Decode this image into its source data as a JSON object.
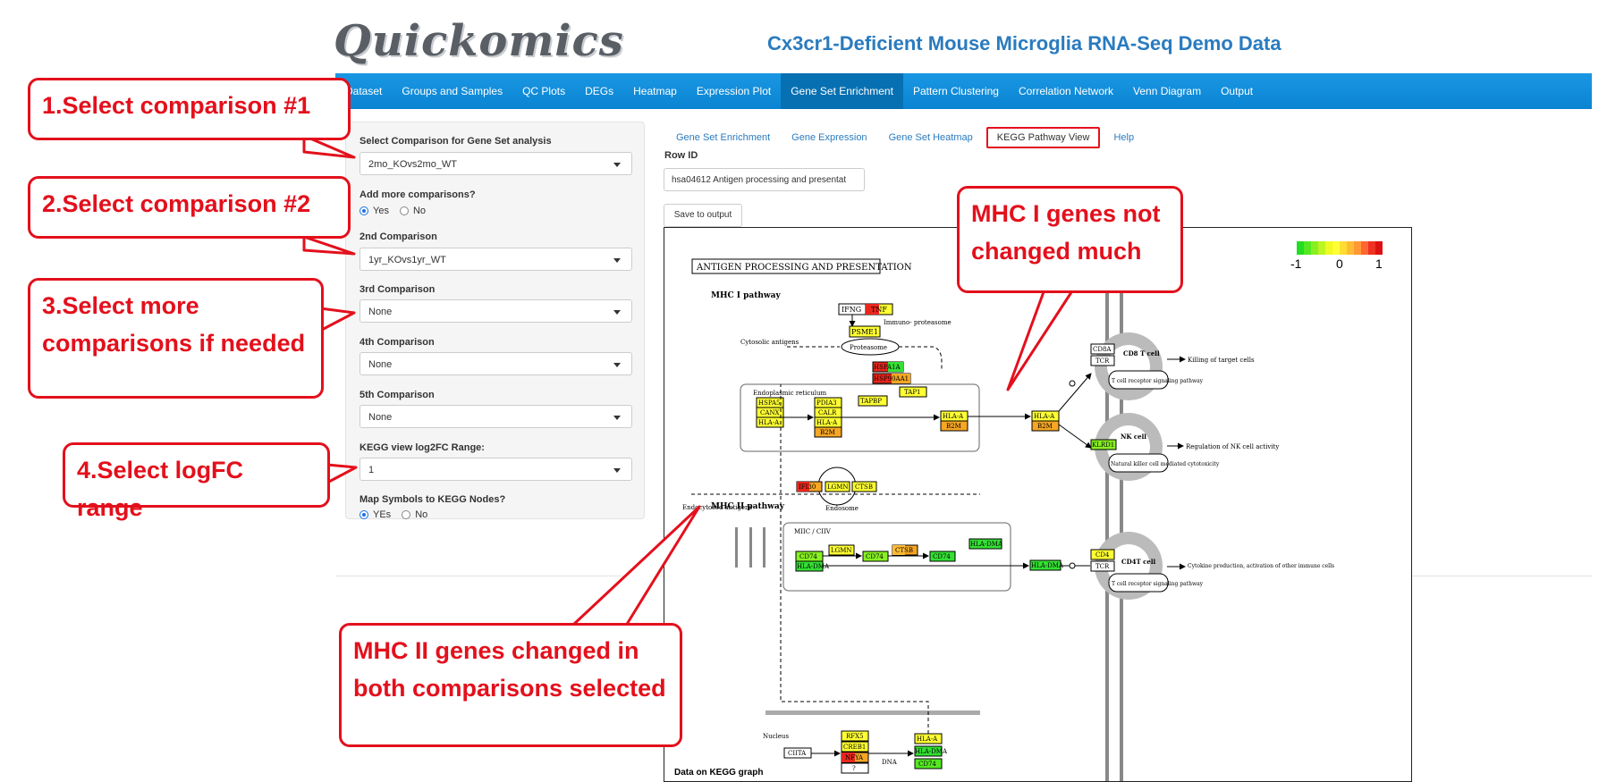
{
  "app": {
    "logo": "Quickomics",
    "title": "Cx3cr1-Deficient Mouse Microglia RNA-Seq Demo Data"
  },
  "nav": [
    "Dataset",
    "Groups and Samples",
    "QC Plots",
    "DEGs",
    "Heatmap",
    "Expression Plot",
    "Gene Set Enrichment",
    "Pattern Clustering",
    "Correlation Network",
    "Venn Diagram",
    "Output"
  ],
  "sidebar": {
    "comp1_label": "Select Comparison for Gene Set analysis",
    "comp1_value": "2mo_KOvs2mo_WT",
    "more_label": "Add more comparisons?",
    "more_yes": "Yes",
    "more_no": "No",
    "comp2_label": "2nd Comparison",
    "comp2_value": "1yr_KOvs1yr_WT",
    "comp3_label": "3rd Comparison",
    "comp3_value": "None",
    "comp4_label": "4th Comparison",
    "comp4_value": "None",
    "comp5_label": "5th Comparison",
    "comp5_value": "None",
    "range_label": "KEGG view log2FC Range:",
    "range_value": "1",
    "map_label": "Map Symbols to KEGG Nodes?",
    "map_yes": "YEs",
    "map_no": "No"
  },
  "subtabs": [
    "Gene Set Enrichment",
    "Gene Expression",
    "Gene Set Heatmap",
    "KEGG Pathway View",
    "Help"
  ],
  "main": {
    "rowid_label": "Row ID",
    "rowid_value": "hsa04612 Antigen processing and presentat",
    "save_label": "Save to output",
    "footer": "Data on KEGG graph"
  },
  "kegg": {
    "title": "ANTIGEN PROCESSING AND PRESENTATION",
    "mhc1": "MHC I pathway",
    "mhc2": "MHC II pathway",
    "scale": [
      "-1",
      "0",
      "1"
    ],
    "cytosolic": "Cytosolic antigens",
    "proteasome": "Proteasome",
    "immuno": "Immuno- proteasome",
    "er": "Endoplasmic reticulum",
    "endocytosed": "Endocytosed antigens",
    "endosome": "Endosome",
    "miic": "MIIC / CIIV",
    "nucleus": "Nucleus",
    "dna": "DNA",
    "cd8": "CD8 T cell",
    "nk": "NK cell",
    "cd4": "CD4T cell",
    "tcr_sig": "T cell receptor signaling pathway",
    "nk_cyto": "Natural killer cell mediated cytotoxicity",
    "killing": "Killing of target cells",
    "reg_nk": "Regulation of NK cell activity",
    "cytokine": "Cytokine production, activation of other immune cells",
    "genes": {
      "ifng": "IFNG",
      "tnf": "TNF",
      "psme1": "PSME1",
      "hspa1a": "HSPA1A",
      "hsp90": "HSP90AA1",
      "tap1": "TAP1",
      "tapbp": "TAPBP",
      "hspa5": "HSPA5",
      "canx": "CANX",
      "hlaa": "HLA-A",
      "pdia3": "PDIA3",
      "calr": "CALR",
      "b2m": "B2M",
      "cd8a": "CD8A",
      "tcr": "TCR",
      "klrd1": "KLRD1",
      "ifi30": "IFI30",
      "lgmn": "LGMN",
      "ctsb": "CTSB",
      "cd74": "CD74",
      "hladma": "HLA-DMA",
      "cd4": "CD4",
      "rfx5": "RFX5",
      "creb1": "CREB1",
      "nfya": "NFYA",
      "q": "?",
      "ciita": "CIITA"
    }
  },
  "callouts": {
    "c1": "1.Select comparison #1",
    "c2": "2.Select comparison #2",
    "c3": "3.Select more comparisons if needed",
    "c4": "4.Select logFC range",
    "c5": "MHC I genes not changed  much",
    "c6": "MHC II genes changed in both comparisons selected"
  },
  "colors": {
    "accent": "#e3101c",
    "nav": "#0a84d2",
    "title": "#2a7bbf",
    "up_red": "#e8261c",
    "neutral_yellow": "#ffff33",
    "down_green": "#33e033",
    "orange": "#f5a623"
  }
}
